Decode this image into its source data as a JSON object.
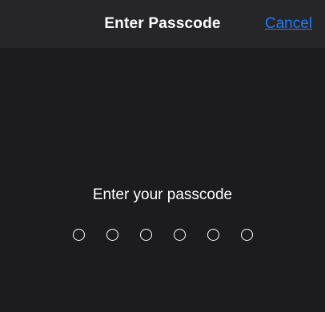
{
  "navbar": {
    "title": "Enter Passcode",
    "cancel_label": "Cancel"
  },
  "passcode": {
    "prompt": "Enter your passcode",
    "length": 6,
    "entered": 0
  },
  "colors": {
    "background": "#1c1c1e",
    "navbar": "#262628",
    "accent": "#1a7cff",
    "text": "#ffffff"
  }
}
